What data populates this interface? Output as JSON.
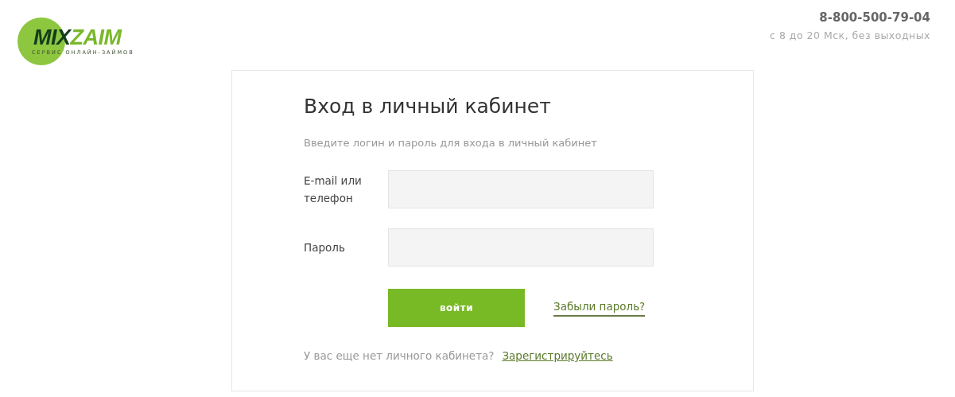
{
  "logo": {
    "part_1": "MIX",
    "part_2": "ZAIM",
    "tagline": "СЕРВИС ОНЛАЙН-ЗАЙМОВ"
  },
  "contact": {
    "phone": "8-800-500-79-04",
    "hours": "с 8 до 20 Мск, без выходных"
  },
  "login": {
    "title": "Вход в личный кабинет",
    "subtitle": "Введите логин и пароль для входа в личный кабинет",
    "fields": [
      {
        "label": "E-mail или телефон"
      },
      {
        "label": "Пароль"
      }
    ],
    "submit": "войти",
    "forgot": "Забыли пароль?",
    "register_prompt": "У вас еще нет личного кабинета?",
    "register_link": "Зарегистрируйтесь"
  }
}
